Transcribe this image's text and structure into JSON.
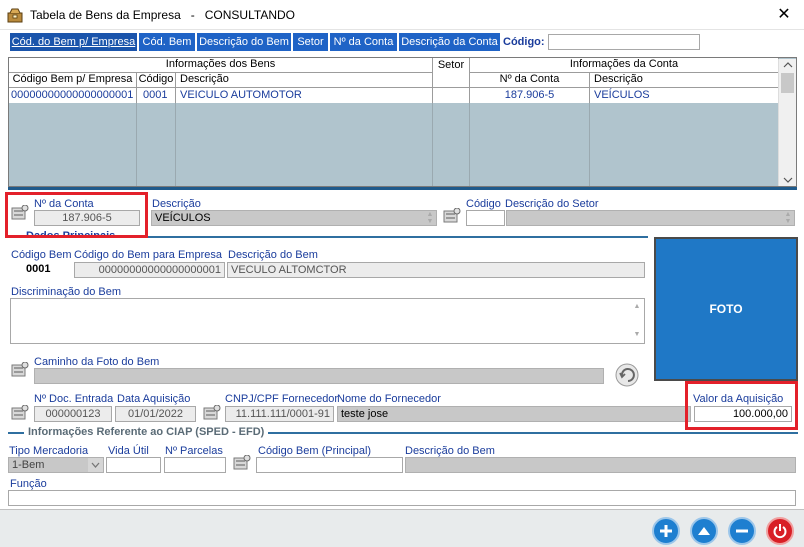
{
  "window": {
    "title": "Tabela de Bens da Empresa   -   CONSULTANDO",
    "close_symbol": "✕"
  },
  "tabs": {
    "items": [
      {
        "label": "Cód. do Bem p/ Empresa"
      },
      {
        "label": "Cód. Bem"
      },
      {
        "label": "Descrição do Bem"
      },
      {
        "label": "Setor"
      },
      {
        "label": "Nº da Conta"
      },
      {
        "label": "Descrição da Conta"
      }
    ],
    "search_label": "Código:",
    "search_value": ""
  },
  "grid": {
    "group_headers": [
      "Informações dos Bens",
      "Setor",
      "Informações da Conta"
    ],
    "columns": [
      "Código Bem p/ Empresa",
      "Código",
      "Descrição",
      "Nº da Conta",
      "Descrição"
    ],
    "rows": [
      {
        "codigo_bem_empresa": "00000000000000000001",
        "codigo": "0001",
        "descricao": "VEICULO AUTOMOTOR",
        "setor": "",
        "n_conta": "187.906-5",
        "descricao_conta": "VEÍCULOS"
      }
    ]
  },
  "conta": {
    "n_conta_label": "Nº da Conta",
    "n_conta_value": "187.906-5",
    "descricao_label": "Descrição",
    "descricao_value": "VEÍCULOS",
    "codigo_label": "Código",
    "codigo_value": "",
    "descricao_setor_label": "Descrição do Setor",
    "descricao_setor_value": ""
  },
  "dados": {
    "section_label": "Dados Principais",
    "codigo_bem_label": "Código Bem",
    "codigo_bem_value": "0001",
    "codigo_empresa_label": "Código do Bem para Empresa",
    "codigo_empresa_value": "00000000000000000001",
    "descricao_bem_label": "Descrição do Bem",
    "descricao_bem_value": "VECULO ALTOMCTOR",
    "discriminacao_label": "Discriminação do Bem",
    "discriminacao_value": "",
    "caminho_foto_label": "Caminho da Foto do Bem",
    "caminho_foto_value": "",
    "foto_label": "FOTO"
  },
  "aquisicao": {
    "n_doc_label": "Nº Doc. Entrada",
    "n_doc_value": "000000123",
    "data_label": "Data Aquisição",
    "data_value": "01/01/2022",
    "cnpj_label": "CNPJ/CPF Fornecedor",
    "cnpj_value": "11.111.111/0001-91",
    "fornecedor_label": "Nome do Fornecedor",
    "fornecedor_value": "teste jose",
    "valor_label": "Valor da Aquisição",
    "valor_value": "100.000,00"
  },
  "ciap": {
    "section_label": "Informações Referente ao CIAP (SPED - EFD)",
    "tipo_label": "Tipo Mercadoria",
    "tipo_value": "1-Bem",
    "vida_label": "Vida Útil",
    "vida_value": "",
    "parcelas_label": "Nº Parcelas",
    "parcelas_value": "",
    "codigo_principal_label": "Código Bem (Principal)",
    "codigo_principal_value": "",
    "descricao_bem_label": "Descrição do Bem",
    "descricao_bem_value": "",
    "funcao_label": "Função",
    "funcao_value": ""
  },
  "colors": {
    "tab_blue": "#1f63c6",
    "highlight_red": "#e3202a",
    "foto_blue": "#1f78c6",
    "grid_bg": "#b0c4cd",
    "btn_blue": "#1e7fd0",
    "btn_red": "#d81f26"
  },
  "icons": [
    "app-icon",
    "close-icon",
    "database-icon",
    "refresh-icon",
    "add-icon",
    "up-icon",
    "remove-icon",
    "power-icon"
  ]
}
